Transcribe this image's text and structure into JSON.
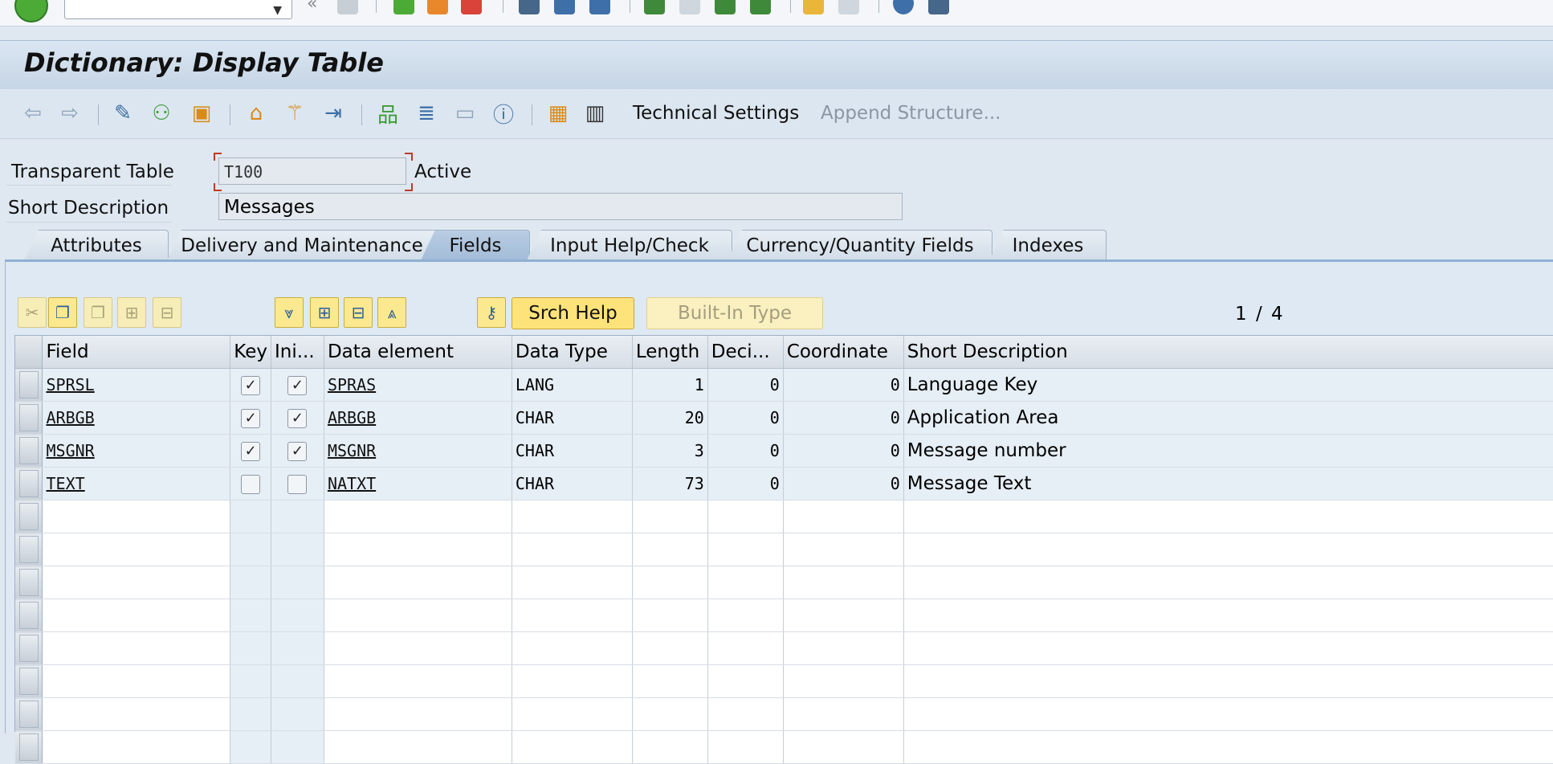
{
  "title": "Dictionary: Display Table",
  "app_toolbar": {
    "technical_settings": "Technical Settings",
    "append_structure": "Append Structure..."
  },
  "header": {
    "table_type_label": "Transparent Table",
    "table_name": "T100",
    "status": "Active",
    "short_desc_label": "Short Description",
    "short_desc": "Messages"
  },
  "tabs": [
    {
      "label": "Attributes"
    },
    {
      "label": "Delivery and Maintenance"
    },
    {
      "label": "Fields"
    },
    {
      "label": "Input Help/Check"
    },
    {
      "label": "Currency/Quantity Fields"
    },
    {
      "label": "Indexes"
    }
  ],
  "active_tab": "Fields",
  "grid_toolbar": {
    "srch_help": "Srch Help",
    "builtin_type": "Built-In Type",
    "pager": "1 / 4"
  },
  "columns": {
    "field": "Field",
    "key": "Key",
    "initial": "Ini...",
    "data_element": "Data element",
    "data_type": "Data Type",
    "length": "Length",
    "decimals": "Deci...",
    "coordinate": "Coordinate",
    "short_description": "Short Description"
  },
  "rows": [
    {
      "field": "SPRSL",
      "key": true,
      "initial": true,
      "data_element": "SPRAS",
      "data_type": "LANG",
      "length": "1",
      "decimals": "0",
      "coordinate": "0",
      "short_description": "Language Key"
    },
    {
      "field": "ARBGB",
      "key": true,
      "initial": true,
      "data_element": "ARBGB",
      "data_type": "CHAR",
      "length": "20",
      "decimals": "0",
      "coordinate": "0",
      "short_description": "Application Area"
    },
    {
      "field": "MSGNR",
      "key": true,
      "initial": true,
      "data_element": "MSGNR",
      "data_type": "CHAR",
      "length": "3",
      "decimals": "0",
      "coordinate": "0",
      "short_description": "Message number"
    },
    {
      "field": "TEXT",
      "key": false,
      "initial": false,
      "data_element": "NATXT",
      "data_type": "CHAR",
      "length": "73",
      "decimals": "0",
      "coordinate": "0",
      "short_description": "Message Text"
    }
  ],
  "colors": {
    "title_bg": "#c6d5e5",
    "row_bg": "#e6eef6",
    "button_yellow": "#fde37a",
    "focus_red": "#c0392b"
  }
}
